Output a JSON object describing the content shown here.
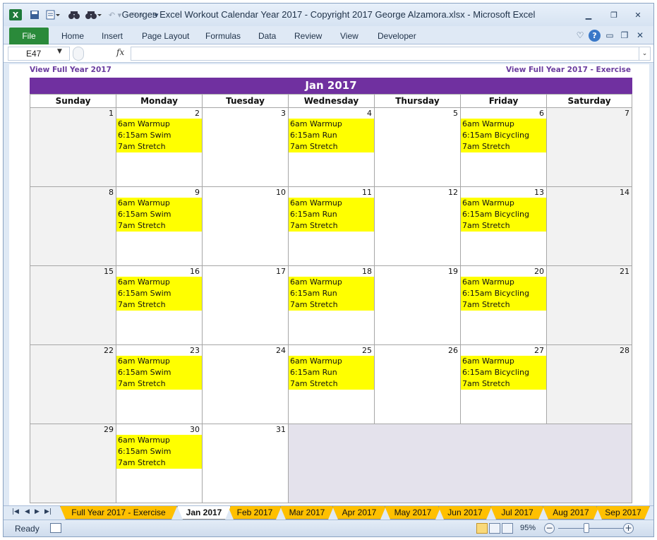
{
  "window": {
    "title": "Georges Excel Workout Calendar Year 2017  -  Copyright 2017 George Alzamora.xlsx  -  Microsoft Excel"
  },
  "ribbon": {
    "file": "File",
    "tabs": [
      "Home",
      "Insert",
      "Page Layout",
      "Formulas",
      "Data",
      "Review",
      "View",
      "Developer"
    ]
  },
  "formula_bar": {
    "name_box": "E47",
    "fx": "fx",
    "formula": ""
  },
  "sheet": {
    "link_left": "View Full Year 2017",
    "link_right": "View Full Year 2017 - Exercise",
    "month_title": "Jan 2017",
    "weekdays": [
      "Sunday",
      "Monday",
      "Tuesday",
      "Wednesday",
      "Thursday",
      "Friday",
      "Saturday"
    ],
    "weeks": [
      [
        {
          "day": "1",
          "events": []
        },
        {
          "day": "2",
          "events": [
            "6am Warmup",
            "6:15am Swim",
            "7am Stretch"
          ]
        },
        {
          "day": "3",
          "events": []
        },
        {
          "day": "4",
          "events": [
            "6am Warmup",
            "6:15am Run",
            "7am Stretch"
          ]
        },
        {
          "day": "5",
          "events": []
        },
        {
          "day": "6",
          "events": [
            "6am Warmup",
            "6:15am Bicycling",
            "7am Stretch"
          ]
        },
        {
          "day": "7",
          "events": []
        }
      ],
      [
        {
          "day": "8",
          "events": []
        },
        {
          "day": "9",
          "events": [
            "6am Warmup",
            "6:15am Swim",
            "7am Stretch"
          ]
        },
        {
          "day": "10",
          "events": []
        },
        {
          "day": "11",
          "events": [
            "6am Warmup",
            "6:15am Run",
            "7am Stretch"
          ]
        },
        {
          "day": "12",
          "events": []
        },
        {
          "day": "13",
          "events": [
            "6am Warmup",
            "6:15am Bicycling",
            "7am Stretch"
          ]
        },
        {
          "day": "14",
          "events": []
        }
      ],
      [
        {
          "day": "15",
          "events": []
        },
        {
          "day": "16",
          "events": [
            "6am Warmup",
            "6:15am Swim",
            "7am Stretch"
          ]
        },
        {
          "day": "17",
          "events": []
        },
        {
          "day": "18",
          "events": [
            "6am Warmup",
            "6:15am Run",
            "7am Stretch"
          ]
        },
        {
          "day": "19",
          "events": []
        },
        {
          "day": "20",
          "events": [
            "6am Warmup",
            "6:15am Bicycling",
            "7am Stretch"
          ]
        },
        {
          "day": "21",
          "events": []
        }
      ],
      [
        {
          "day": "22",
          "events": []
        },
        {
          "day": "23",
          "events": [
            "6am Warmup",
            "6:15am Swim",
            "7am Stretch"
          ]
        },
        {
          "day": "24",
          "events": []
        },
        {
          "day": "25",
          "events": [
            "6am Warmup",
            "6:15am Run",
            "7am Stretch"
          ]
        },
        {
          "day": "26",
          "events": []
        },
        {
          "day": "27",
          "events": [
            "6am Warmup",
            "6:15am Bicycling",
            "7am Stretch"
          ]
        },
        {
          "day": "28",
          "events": []
        }
      ],
      [
        {
          "day": "29",
          "events": []
        },
        {
          "day": "30",
          "events": [
            "6am Warmup",
            "6:15am Swim",
            "7am Stretch"
          ]
        },
        {
          "day": "31",
          "events": []
        }
      ]
    ]
  },
  "sheet_tabs": [
    {
      "label": "Full Year 2017 - Exercise",
      "active": false
    },
    {
      "label": "Jan 2017",
      "active": true
    },
    {
      "label": "Feb 2017",
      "active": false
    },
    {
      "label": "Mar 2017",
      "active": false
    },
    {
      "label": "Apr 2017",
      "active": false
    },
    {
      "label": "May 2017",
      "active": false
    },
    {
      "label": "Jun 2017",
      "active": false
    },
    {
      "label": "Jul 2017",
      "active": false
    },
    {
      "label": "Aug 2017",
      "active": false
    },
    {
      "label": "Sep 2017",
      "active": false
    }
  ],
  "status": {
    "ready": "Ready",
    "zoom": "95%"
  },
  "colors": {
    "month_header": "#7030a0",
    "event_fill": "#ffff00",
    "sheet_tab": "#ffc000",
    "file_tab": "#2a8a3a"
  }
}
